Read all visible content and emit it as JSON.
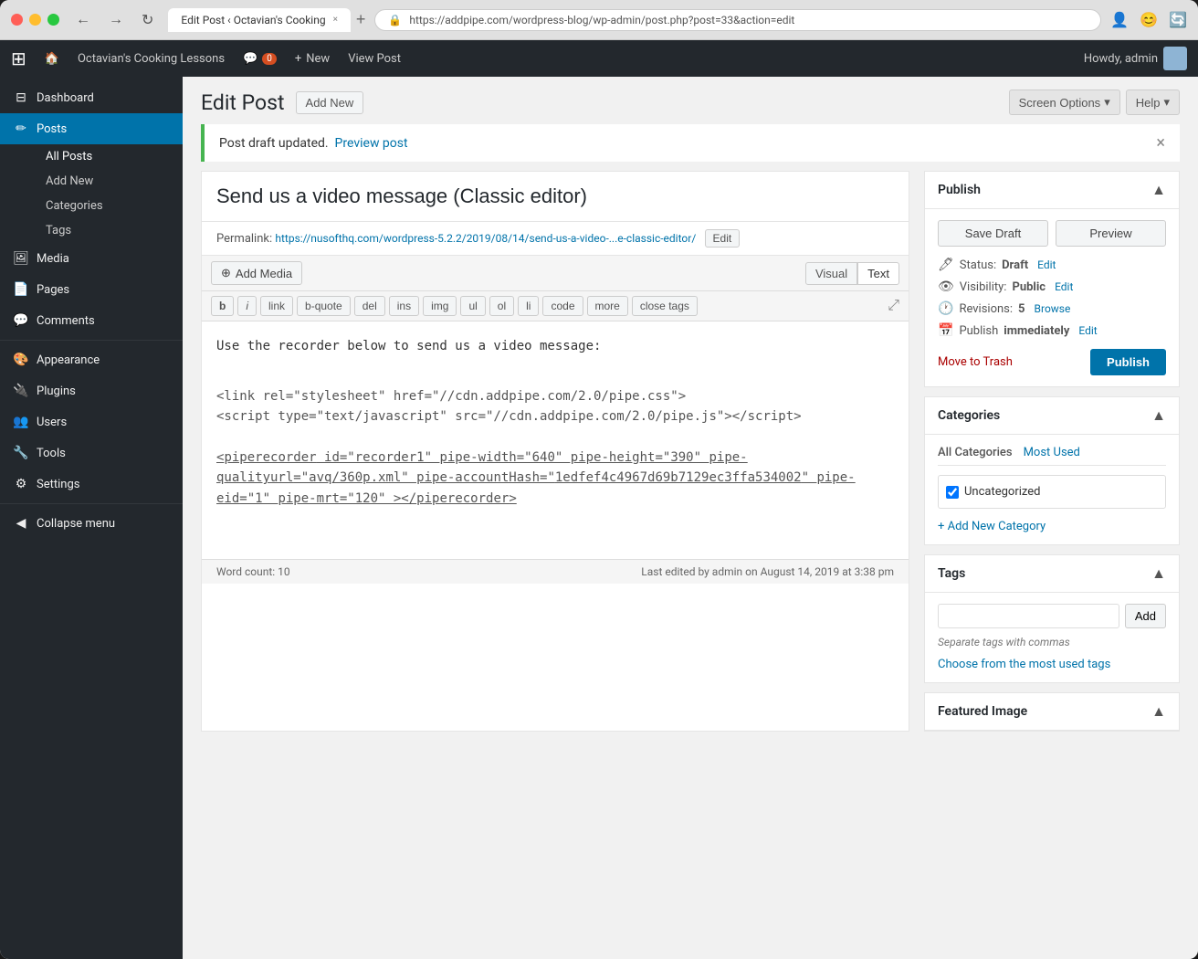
{
  "browser": {
    "tab_title": "Edit Post ‹ Octavian's Cooking",
    "url": "https://addpipe.com/wordpress-blog/wp-admin/post.php?post=33&action=edit",
    "back_label": "←",
    "forward_label": "→",
    "refresh_label": "↻"
  },
  "admin_bar": {
    "site_name": "Octavian's Cooking Lessons",
    "comments_count": "0",
    "new_label": "New",
    "view_post_label": "View Post",
    "howdy_label": "Howdy, admin"
  },
  "sidebar": {
    "dashboard": "Dashboard",
    "posts": "Posts",
    "all_posts": "All Posts",
    "add_new": "Add New",
    "categories": "Categories",
    "tags": "Tags",
    "media": "Media",
    "pages": "Pages",
    "comments": "Comments",
    "appearance": "Appearance",
    "plugins": "Plugins",
    "users": "Users",
    "tools": "Tools",
    "settings": "Settings",
    "collapse_menu": "Collapse menu"
  },
  "page": {
    "title": "Edit Post",
    "add_new_label": "Add New",
    "screen_options_label": "Screen Options",
    "help_label": "Help"
  },
  "notice": {
    "message": "Post draft updated.",
    "preview_link_text": "Preview post"
  },
  "post": {
    "title": "Send us a video message (Classic editor)",
    "permalink_label": "Permalink:",
    "permalink_url": "https://nusofthq.com/wordpress-5.2.2/2019/08/14/send-us-a-video-...e-classic-editor/",
    "edit_label": "Edit",
    "content_line1": "Use the recorder below to send us a video message:",
    "content_line2": "<link rel=\"stylesheet\" href=\"//cdn.addpipe.com/2.0/pipe.css\">",
    "content_line3": "<script type=\"text/javascript\" src=\"//cdn.addpipe.com/2.0/pipe.js\"><\\/script>",
    "content_line4": "<piperecorder id=\"recorder1\" pipe-width=\"640\" pipe-height=\"390\" pipe-qualityurl=\"avq/360p.xml\" pipe-accountHash=\"1edfef4c4967d69b7129ec3ffa534002\" pipe-eid=\"1\" pipe-mrt=\"120\" ></piperecorder>",
    "word_count_label": "Word count: 10",
    "last_edited_label": "Last edited by admin on August 14, 2019 at 3:38 pm",
    "add_media_label": "Add Media",
    "visual_label": "Visual",
    "text_label": "Text",
    "fmt_b": "b",
    "fmt_i": "i",
    "fmt_link": "link",
    "fmt_bquote": "b-quote",
    "fmt_del": "del",
    "fmt_ins": "ins",
    "fmt_img": "img",
    "fmt_ul": "ul",
    "fmt_ol": "ol",
    "fmt_li": "li",
    "fmt_code": "code",
    "fmt_more": "more",
    "fmt_close": "close tags"
  },
  "publish_panel": {
    "title": "Publish",
    "save_draft_label": "Save Draft",
    "preview_label": "Preview",
    "status_label": "Status:",
    "status_value": "Draft",
    "edit_status_label": "Edit",
    "visibility_label": "Visibility:",
    "visibility_value": "Public",
    "edit_visibility_label": "Edit",
    "revisions_label": "Revisions:",
    "revisions_value": "5",
    "browse_label": "Browse",
    "publish_time_label": "Publish",
    "publish_time_value": "immediately",
    "edit_time_label": "Edit",
    "move_to_trash_label": "Move to Trash",
    "publish_btn_label": "Publish"
  },
  "categories_panel": {
    "title": "Categories",
    "all_tab": "All Categories",
    "most_used_tab": "Most Used",
    "uncategorized_label": "Uncategorized",
    "add_new_label": "+ Add New Category"
  },
  "tags_panel": {
    "title": "Tags",
    "input_placeholder": "",
    "add_label": "Add",
    "hint": "Separate tags with commas",
    "choose_link": "Choose from the most used tags"
  },
  "featured_image_panel": {
    "title": "Featured Image"
  }
}
